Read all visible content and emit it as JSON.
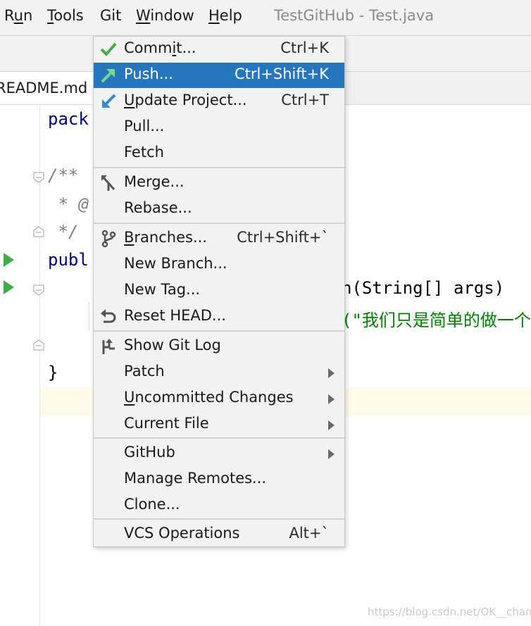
{
  "menubar": {
    "items": [
      {
        "label": "Run",
        "mnemonic": "u"
      },
      {
        "label": "Tools",
        "mnemonic": "T"
      },
      {
        "label": "Git",
        "mnemonic": ""
      },
      {
        "label": "Window",
        "mnemonic": "W"
      },
      {
        "label": "Help",
        "mnemonic": "H"
      }
    ],
    "title": "TestGitHub - Test.java"
  },
  "tabs": [
    {
      "label": "README.md"
    }
  ],
  "editor": {
    "lines": [
      {
        "text": "pack"
      },
      {
        "text": "/**"
      },
      {
        "text": " * @"
      },
      {
        "text": " */"
      },
      {
        "text": "publ"
      },
      {
        "text": "n(String[] args)"
      },
      {
        "text": "(\"我们只是简单的做一个"
      },
      {
        "text": "}"
      }
    ]
  },
  "git_menu": {
    "items": [
      {
        "label": "Commit...",
        "mnemonic": "i",
        "shortcut": "Ctrl+K",
        "icon": "check-icon"
      },
      {
        "label": "Push...",
        "shortcut": "Ctrl+Shift+K",
        "icon": "push-arrow-icon",
        "highlighted": true
      },
      {
        "label": "Update Project...",
        "mnemonic": "U",
        "shortcut": "Ctrl+T",
        "icon": "update-arrow-icon"
      },
      {
        "label": "Pull..."
      },
      {
        "label": "Fetch"
      },
      {
        "label": "Merge...",
        "icon": "merge-icon"
      },
      {
        "label": "Rebase..."
      },
      {
        "label": "Branches...",
        "mnemonic": "B",
        "shortcut": "Ctrl+Shift+`",
        "icon": "branch-icon"
      },
      {
        "label": "New Branch..."
      },
      {
        "label": "New Tag..."
      },
      {
        "label": "Reset HEAD...",
        "icon": "reset-icon"
      },
      {
        "label": "Show Git Log",
        "icon": "git-log-icon"
      },
      {
        "label": "Patch",
        "submenu": true
      },
      {
        "label": "Uncommitted Changes",
        "mnemonic": "U",
        "submenu": true
      },
      {
        "label": "Current File",
        "submenu": true
      },
      {
        "label": "GitHub",
        "submenu": true
      },
      {
        "label": "Manage Remotes..."
      },
      {
        "label": "Clone..."
      },
      {
        "label": "VCS Operations",
        "shortcut": "Alt+`"
      }
    ]
  },
  "watermark": "https://blog.csdn.net/OK__chan",
  "colors": {
    "highlight": "#2675bf",
    "check": "#3fae49",
    "string": "#008000",
    "keyword": "#000080"
  }
}
